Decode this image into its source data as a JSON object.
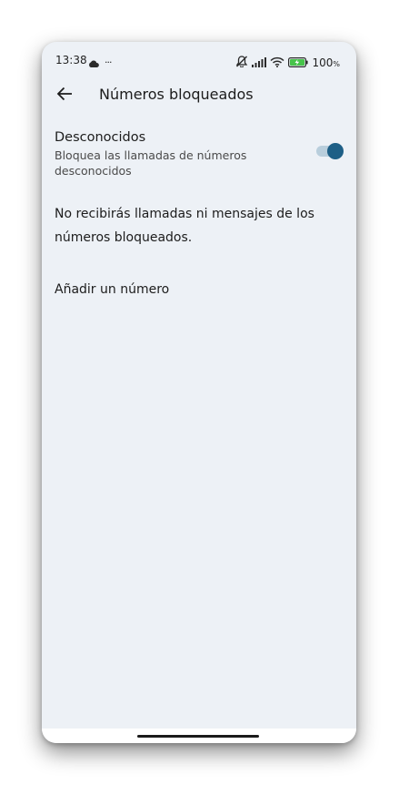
{
  "status_bar": {
    "time": "13:38",
    "more_indicator": "···",
    "battery_percent": "100",
    "battery_percent_sign": "%",
    "icons": [
      "cloud-icon",
      "silent-icon",
      "signal-icon",
      "wifi-icon",
      "battery-icon"
    ]
  },
  "app_bar": {
    "title": "Números bloqueados",
    "back_icon": "arrow-left-icon"
  },
  "setting": {
    "title": "Desconocidos",
    "description": "Bloquea las llamadas de números desconocidos",
    "toggle_on": true
  },
  "info": {
    "text": "No recibirás llamadas ni mensajes de los números bloqueados."
  },
  "add_number": {
    "label": "Añadir un número"
  },
  "colors": {
    "background": "#edf1f6",
    "accent": "#1e5f86",
    "toggle_track": "#b9cedc",
    "battery_fill": "#46c44a"
  }
}
